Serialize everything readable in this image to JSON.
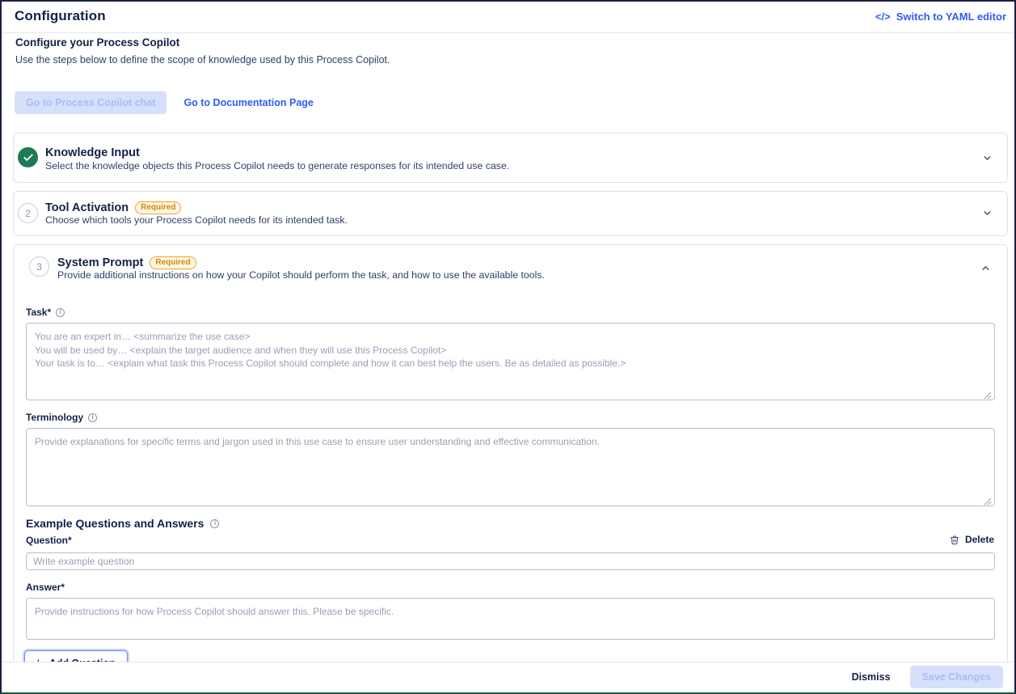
{
  "header": {
    "title": "Configuration",
    "yaml_link": "Switch to YAML editor",
    "code_icon": "code-icon"
  },
  "intro": {
    "title": "Configure your Process Copilot",
    "subtitle": "Use the steps below to define the scope of knowledge used by this Process Copilot.",
    "chat_button": "Go to Process Copilot chat",
    "docs_link": "Go to Documentation Page"
  },
  "sections": [
    {
      "number": "1",
      "state": "complete",
      "title": "Knowledge Input",
      "description": "Select the knowledge objects this Process Copilot needs to generate responses for its intended use case.",
      "badge": "",
      "expanded": false,
      "chevron": "chevron-down-icon"
    },
    {
      "number": "2",
      "state": "pending",
      "title": "Tool Activation",
      "description": "Choose which tools your Process Copilot needs for its intended task.",
      "badge": "Required",
      "expanded": false,
      "chevron": "chevron-down-icon"
    },
    {
      "number": "3",
      "state": "pending",
      "title": "System Prompt",
      "description": "Provide additional instructions on how your Copilot should perform the task, and how to use the available tools.",
      "badge": "Required",
      "expanded": true,
      "chevron": "chevron-up-icon"
    }
  ],
  "form": {
    "task": {
      "label": "Task*",
      "value": "",
      "placeholder": "You are an expert in… <summarize the use case>\nYou will be used by… <explain the target audience and when they will use this Process Copilot>\nYour task is to… <explain what task this Process Copilot should complete and how it can best help the users. Be as detailed as possible.>"
    },
    "terminology": {
      "label": "Terminology",
      "value": "",
      "placeholder": "Provide explanations for specific terms and jargon used in this use case to ensure user understanding and effective communication."
    },
    "examples": {
      "title": "Example Questions and Answers",
      "delete_label": "Delete",
      "delete_icon": "trash-icon",
      "question": {
        "label": "Question*",
        "value": "",
        "placeholder": "Write example question"
      },
      "answer": {
        "label": "Answer*",
        "value": "",
        "placeholder": "Provide instructions for how Process Copilot should answer this. Please be specific."
      },
      "add_button": "Add Question"
    }
  },
  "footer": {
    "dismiss": "Dismiss",
    "save": "Save Changes"
  },
  "colors": {
    "accent": "#2f5cf6",
    "complete": "#1d7a54",
    "required_badge_border": "#e3a726",
    "required_badge_text": "#d48806",
    "disabled_button_bg": "#d6e0fb"
  }
}
